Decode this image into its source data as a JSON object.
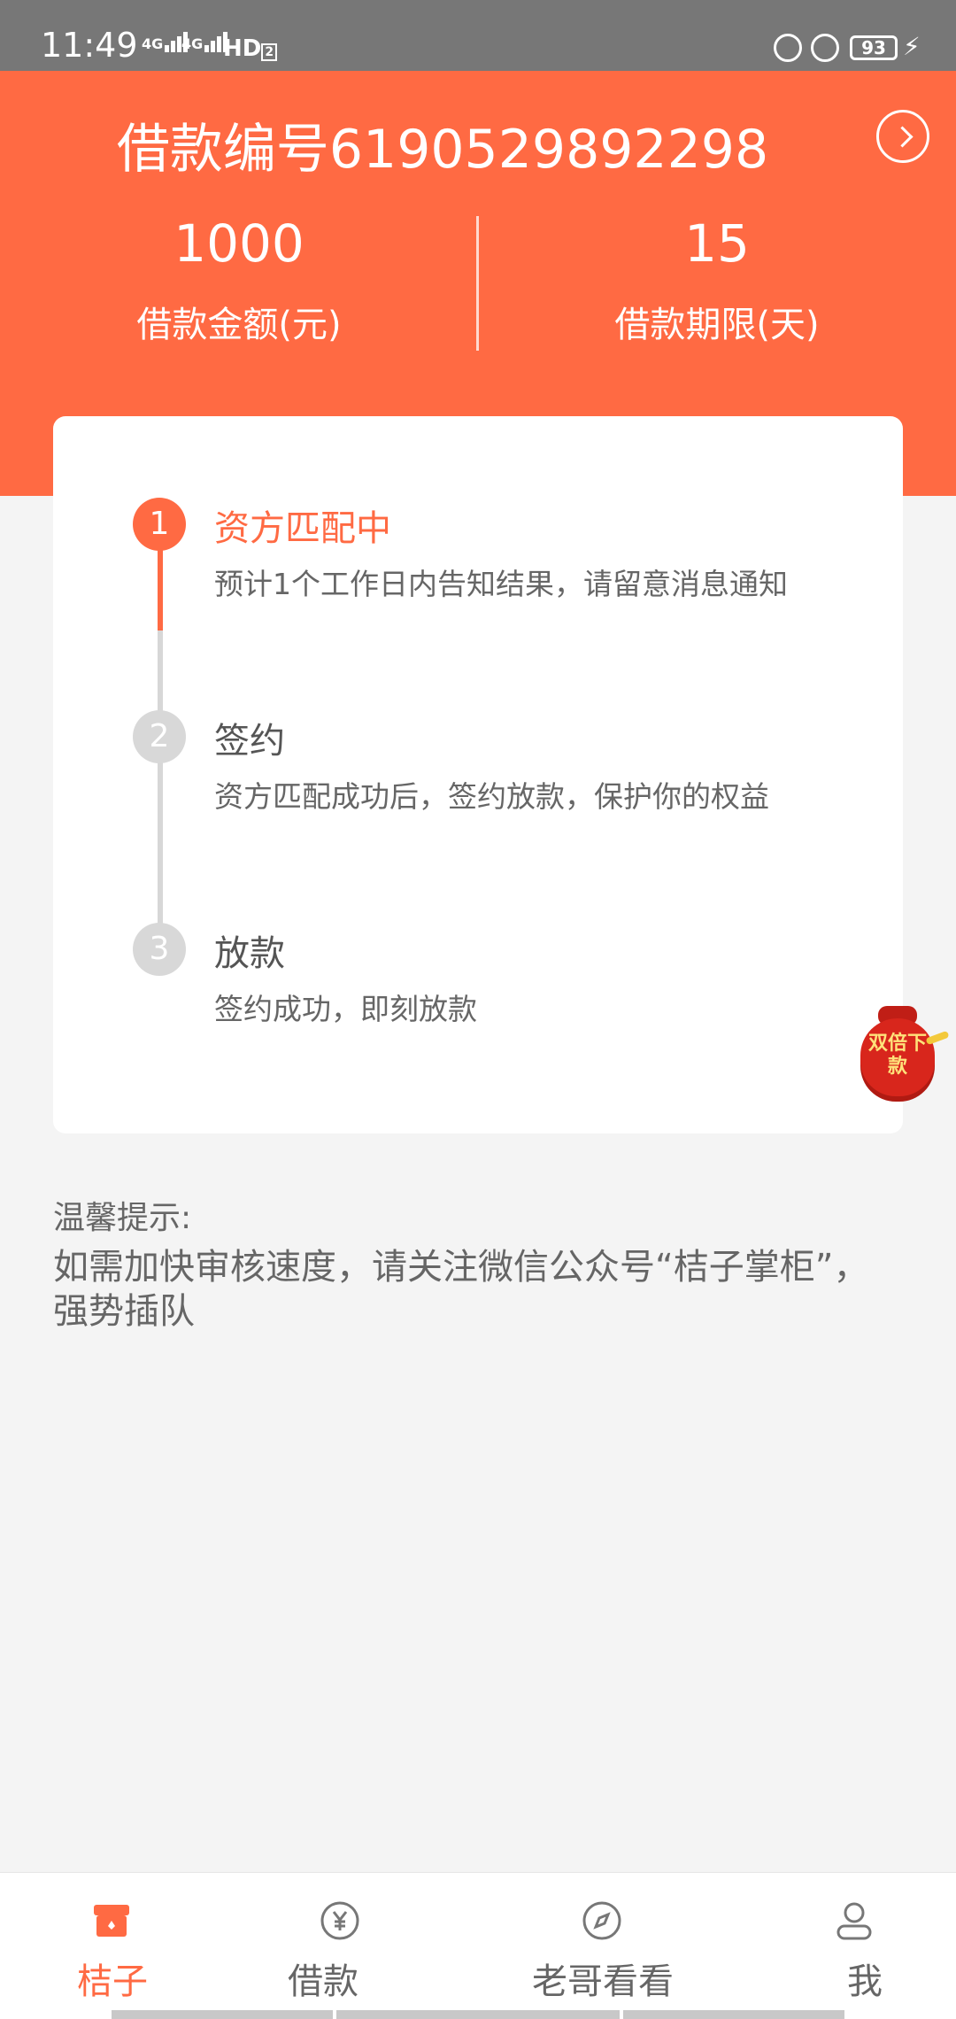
{
  "status_bar": {
    "time": "11:49",
    "signal1": "4G",
    "signal2": "4G",
    "hd": "HD",
    "hd_sub": "2",
    "battery": "93"
  },
  "header": {
    "title": "借款编号6190529892298",
    "amount_value": "1000",
    "amount_label": "借款金额(元)",
    "term_value": "15",
    "term_label": "借款期限(天)"
  },
  "steps": [
    {
      "number": "1",
      "title": "资方匹配中",
      "desc": "预计1个工作日内告知结果，请留意消息通知",
      "active": true
    },
    {
      "number": "2",
      "title": "签约",
      "desc": "资方匹配成功后，签约放款，保护你的权益",
      "active": false
    },
    {
      "number": "3",
      "title": "放款",
      "desc": "签约成功，即刻放款",
      "active": false
    }
  ],
  "promo": {
    "text": "双倍下款"
  },
  "tips": {
    "title": "温馨提示:",
    "body": "如需加快审核速度，请关注微信公众号“桔子掌柜”，强势插队"
  },
  "nav": {
    "items": [
      {
        "label": "桔子",
        "icon": "store-icon",
        "active": true
      },
      {
        "label": "借款",
        "icon": "yen-icon",
        "active": false
      },
      {
        "label": "老哥看看",
        "icon": "compass-icon",
        "active": false
      },
      {
        "label": "我",
        "icon": "user-icon",
        "active": false
      }
    ]
  },
  "colors": {
    "accent": "#ff6a43",
    "status_bar": "#777777",
    "background": "#f4f4f4"
  }
}
